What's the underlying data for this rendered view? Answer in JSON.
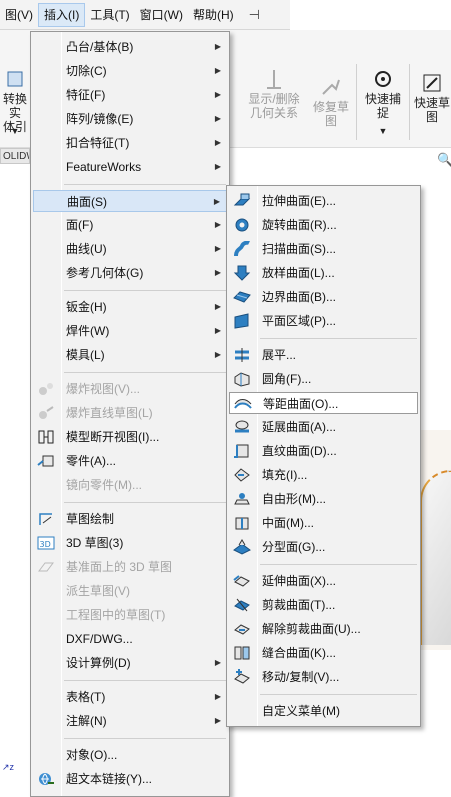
{
  "menubar": {
    "items": [
      {
        "label": "图(V)"
      },
      {
        "label": "插入(I)"
      },
      {
        "label": "工具(T)"
      },
      {
        "label": "窗口(W)"
      },
      {
        "label": "帮助(H)"
      }
    ],
    "pin_icon": "pin-icon"
  },
  "toolbar": {
    "convert_label": "转换实\n体引",
    "show_delete_label": "显示/删除\n几何关系",
    "repair_label": "修复草\n图",
    "quick_snap_label": "快速捕\n捉",
    "quick_sketch_label": "快速草\n图",
    "tab_label": "OLIDW"
  },
  "main_menu": {
    "items": [
      {
        "label": "凸台/基体(B)",
        "submenu": true
      },
      {
        "label": "切除(C)",
        "submenu": true
      },
      {
        "label": "特征(F)",
        "submenu": true
      },
      {
        "label": "阵列/镜像(E)",
        "submenu": true
      },
      {
        "label": "扣合特征(T)",
        "submenu": true
      },
      {
        "label": "FeatureWorks",
        "submenu": true
      },
      {
        "label": "曲面(S)",
        "submenu": true
      },
      {
        "label": "面(F)",
        "submenu": true
      },
      {
        "label": "曲线(U)",
        "submenu": true
      },
      {
        "label": "参考几何体(G)",
        "submenu": true
      },
      {
        "label": "钣金(H)",
        "submenu": true
      },
      {
        "label": "焊件(W)",
        "submenu": true
      },
      {
        "label": "模具(L)",
        "submenu": true
      },
      {
        "label": "爆炸视图(V)...",
        "disabled": true
      },
      {
        "label": "爆炸直线草图(L)",
        "disabled": true
      },
      {
        "label": "模型断开视图(I)..."
      },
      {
        "label": "零件(A)..."
      },
      {
        "label": "镜向零件(M)...",
        "disabled": true
      },
      {
        "label": "草图绘制"
      },
      {
        "label": "3D 草图(3)"
      },
      {
        "label": "基准面上的 3D 草图",
        "disabled": true
      },
      {
        "label": "派生草图(V)",
        "disabled": true
      },
      {
        "label": "工程图中的草图(T)",
        "disabled": true
      },
      {
        "label": "DXF/DWG..."
      },
      {
        "label": "设计算例(D)",
        "submenu": true
      },
      {
        "label": "表格(T)",
        "submenu": true
      },
      {
        "label": "注解(N)",
        "submenu": true
      },
      {
        "label": "对象(O)..."
      },
      {
        "label": "超文本链接(Y)..."
      }
    ]
  },
  "surface_menu": {
    "items": [
      {
        "label": "拉伸曲面(E)...",
        "icon": "extruded-surface-icon"
      },
      {
        "label": "旋转曲面(R)...",
        "icon": "revolved-surface-icon"
      },
      {
        "label": "扫描曲面(S)...",
        "icon": "swept-surface-icon"
      },
      {
        "label": "放样曲面(L)...",
        "icon": "lofted-surface-icon"
      },
      {
        "label": "边界曲面(B)...",
        "icon": "boundary-surface-icon"
      },
      {
        "label": "平面区域(P)...",
        "icon": "planar-surface-icon"
      },
      {
        "label": "展平...",
        "icon": "flatten-icon"
      },
      {
        "label": "圆角(F)...",
        "icon": "fillet-icon"
      },
      {
        "label": "等距曲面(O)...",
        "icon": "offset-surface-icon"
      },
      {
        "label": "延展曲面(A)...",
        "icon": "radiate-surface-icon"
      },
      {
        "label": "直纹曲面(D)...",
        "icon": "ruled-surface-icon"
      },
      {
        "label": "填充(I)...",
        "icon": "filled-surface-icon"
      },
      {
        "label": "自由形(M)...",
        "icon": "freeform-icon"
      },
      {
        "label": "中面(M)...",
        "icon": "mid-surface-icon"
      },
      {
        "label": "分型面(G)...",
        "icon": "parting-surface-icon"
      },
      {
        "label": "延伸曲面(X)...",
        "icon": "extend-surface-icon"
      },
      {
        "label": "剪裁曲面(T)...",
        "icon": "trim-surface-icon"
      },
      {
        "label": "解除剪裁曲面(U)...",
        "icon": "untrim-surface-icon"
      },
      {
        "label": "缝合曲面(K)...",
        "icon": "knit-surface-icon"
      },
      {
        "label": "移动/复制(V)...",
        "icon": "move-copy-icon"
      },
      {
        "label": "自定义菜单(M)"
      }
    ]
  },
  "colors": {
    "menu_bg": "#f2f2f2",
    "highlight": "#d9e7f7",
    "icon_blue": "#2d7fc1",
    "disabled_text": "#a4a4a4"
  }
}
